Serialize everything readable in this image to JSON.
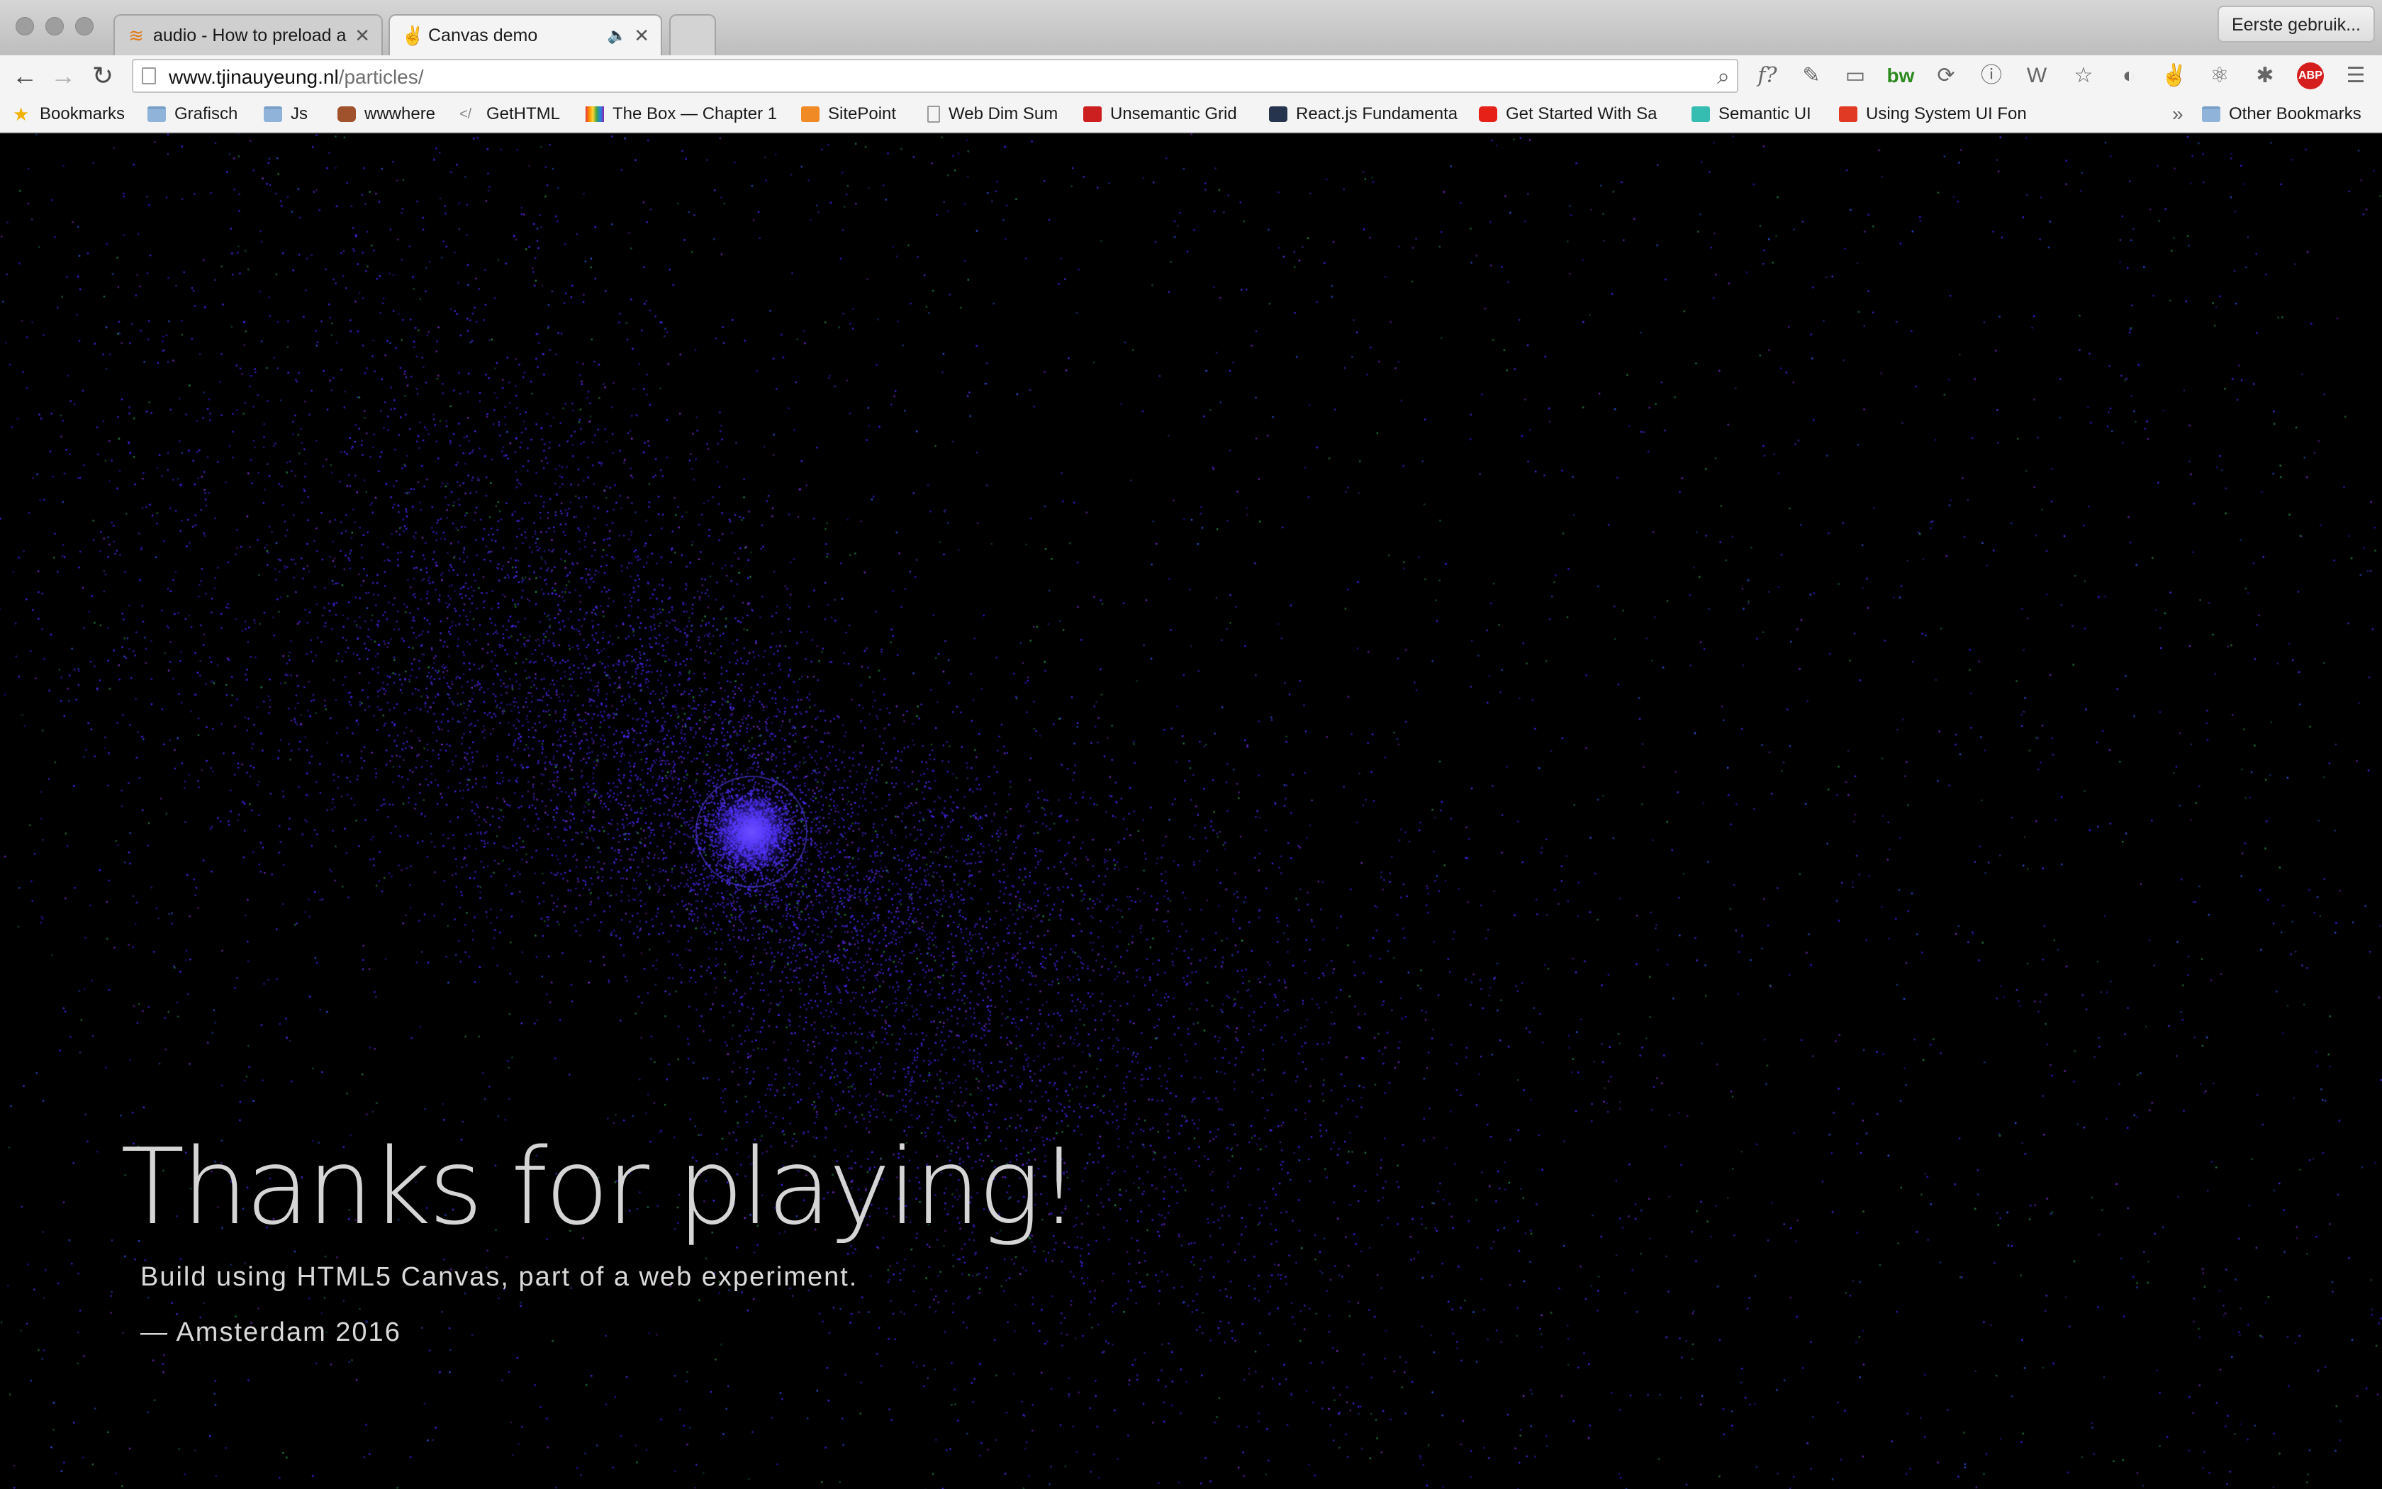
{
  "browser": {
    "tabs": [
      {
        "title": "audio - How to preload a so",
        "favicon": "stackoverflow-icon",
        "active": false
      },
      {
        "title": "Canvas demo",
        "favicon": "victory-hand-icon",
        "active": true
      }
    ],
    "profile_button": "Eerste gebruik...",
    "url_host": "www.tjinauyeung.nl",
    "url_path": "/particles/",
    "extension_labels": {
      "abp": "ABP",
      "bw": "bw",
      "fonts": "f?"
    },
    "bookmarks": [
      {
        "label": "Bookmarks",
        "icon": "star-icon"
      },
      {
        "label": "Grafisch",
        "icon": "folder-icon"
      },
      {
        "label": "Js",
        "icon": "folder-icon"
      },
      {
        "label": "wwwhere",
        "icon": "owl-icon"
      },
      {
        "label": "GetHTML",
        "icon": "code-icon"
      },
      {
        "label": "The Box — Chapter 1",
        "icon": "rainbow-icon"
      },
      {
        "label": "SitePoint",
        "icon": "sitepoint-icon"
      },
      {
        "label": "Web Dim Sum",
        "icon": "document-icon"
      },
      {
        "label": "Unsemantic Grid",
        "icon": "unsemantic-icon"
      },
      {
        "label": "React.js Fundamenta",
        "icon": "react-icon"
      },
      {
        "label": "Get Started With Sa",
        "icon": "youtube-icon"
      },
      {
        "label": "Semantic UI",
        "icon": "semantic-icon"
      },
      {
        "label": "Using System UI Fon",
        "icon": "smashing-icon"
      }
    ],
    "overflow_chevron": "»",
    "other_bookmarks": "Other Bookmarks"
  },
  "page": {
    "headline": "Thanks for playing!",
    "subtitle": "Build using HTML5 Canvas, part of a web experiment.",
    "signature": "— Amsterdam 2016",
    "colors": {
      "background": "#000000",
      "particle_primary": "#3b1cff",
      "particle_accent_green": "#2fa85a",
      "particle_accent_purple": "#a23cff"
    }
  }
}
